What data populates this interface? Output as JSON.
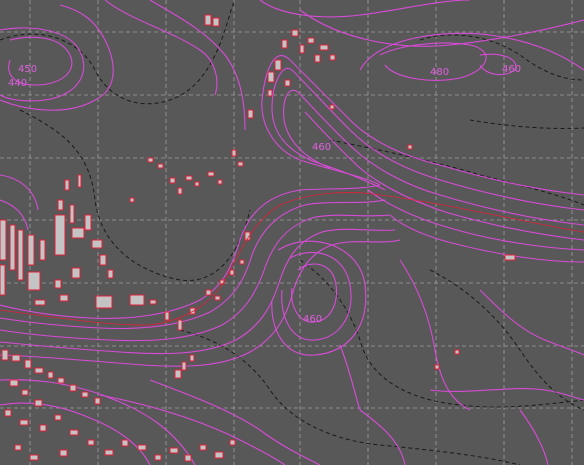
{
  "map": {
    "background_color": "#585858",
    "contour_color": "#d84bd8",
    "dashed_contour_color": "#1a1a1a",
    "grid_color": "#bdbdbd",
    "building_fill": "#c4c4c4",
    "building_stroke": "#e0203a",
    "contour_labels": [
      {
        "id": "label-450",
        "text": "450"
      },
      {
        "id": "label-440",
        "text": "440"
      },
      {
        "id": "label-460-ne",
        "text": "460"
      },
      {
        "id": "label-480-e",
        "text": "480"
      },
      {
        "id": "label-460-center",
        "text": "460"
      },
      {
        "id": "label-460-south",
        "text": "460"
      }
    ]
  }
}
